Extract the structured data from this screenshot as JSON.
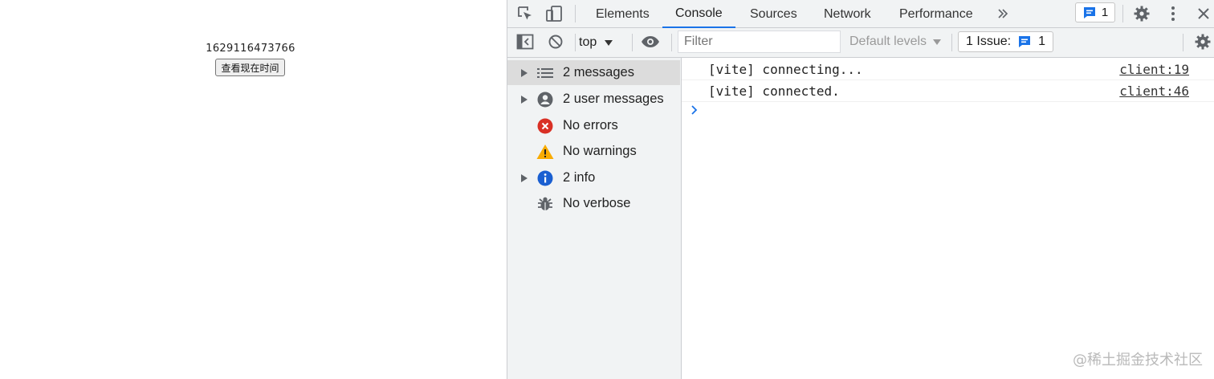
{
  "webpage": {
    "timestamp": "1629116473766",
    "button_label": "查看现在时间"
  },
  "devtools": {
    "tabs": [
      {
        "label": "Elements",
        "active": false
      },
      {
        "label": "Console",
        "active": true
      },
      {
        "label": "Sources",
        "active": false
      },
      {
        "label": "Network",
        "active": false
      },
      {
        "label": "Performance",
        "active": false
      }
    ],
    "more_tabs_icon": "double-chevron-right-icon",
    "issue_badge_count": "1",
    "icons": [
      "inspect-element-icon",
      "device-toolbar-icon",
      "gear-icon",
      "kebab-menu-icon",
      "close-icon"
    ],
    "toolbar": {
      "context": "top",
      "filter_placeholder": "Filter",
      "levels": "Default levels",
      "issues_label": "1 Issue:",
      "issues_count": "1"
    },
    "sidebar": [
      {
        "label": "2 messages",
        "icon": "list-icon",
        "expandable": true,
        "selected": true
      },
      {
        "label": "2 user messages",
        "icon": "user-circle-icon",
        "expandable": true,
        "selected": false
      },
      {
        "label": "No errors",
        "icon": "error-icon",
        "expandable": false,
        "selected": false
      },
      {
        "label": "No warnings",
        "icon": "warning-icon",
        "expandable": false,
        "selected": false
      },
      {
        "label": "2 info",
        "icon": "info-icon",
        "expandable": true,
        "selected": false
      },
      {
        "label": "No verbose",
        "icon": "bug-icon",
        "expandable": false,
        "selected": false
      }
    ],
    "logs": [
      {
        "text": "[vite] connecting...",
        "source": "client:19"
      },
      {
        "text": "[vite] connected.",
        "source": "client:46"
      }
    ],
    "colors": {
      "accent": "#1a73e8",
      "error": "#d93025",
      "warning": "#f9ab00",
      "info": "#1a5fd1"
    }
  },
  "watermark": "@稀土掘金技术社区"
}
